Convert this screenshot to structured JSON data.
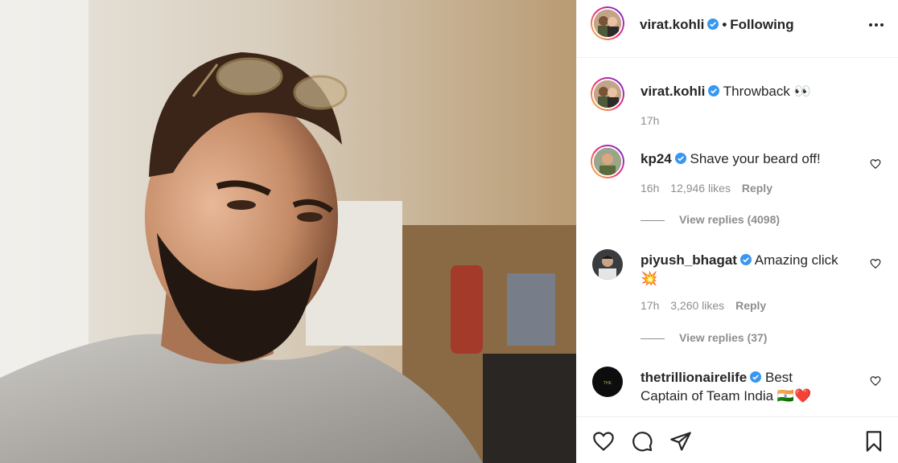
{
  "post": {
    "image_alt": "",
    "colors": {
      "verified": "#3897f0",
      "muted": "#8e8e8e",
      "text": "#262626",
      "heart_emoji": "#e0245e"
    }
  },
  "header": {
    "username": "virat.kohli",
    "separator": "•",
    "follow_status": "Following",
    "more_icon": "more-horizontal-icon"
  },
  "caption": {
    "username": "virat.kohli",
    "text": "Throwback 👀",
    "time": "17h"
  },
  "comments": [
    {
      "username": "kp24",
      "text": "Shave your beard off!",
      "time": "16h",
      "likes": "12,946 likes",
      "reply": "Reply",
      "view_replies": "View replies (4098)"
    },
    {
      "username": "piyush_bhagat",
      "text": "Amazing click 💥",
      "time": "17h",
      "likes": "3,260 likes",
      "reply": "Reply",
      "view_replies": "View replies (37)"
    },
    {
      "username": "thetrillionairelife",
      "text": "Best Captain of Team India 🇮🇳❤️"
    }
  ],
  "footer": {
    "icons": [
      "heart-icon",
      "comment-icon",
      "share-icon",
      "bookmark-icon"
    ]
  }
}
